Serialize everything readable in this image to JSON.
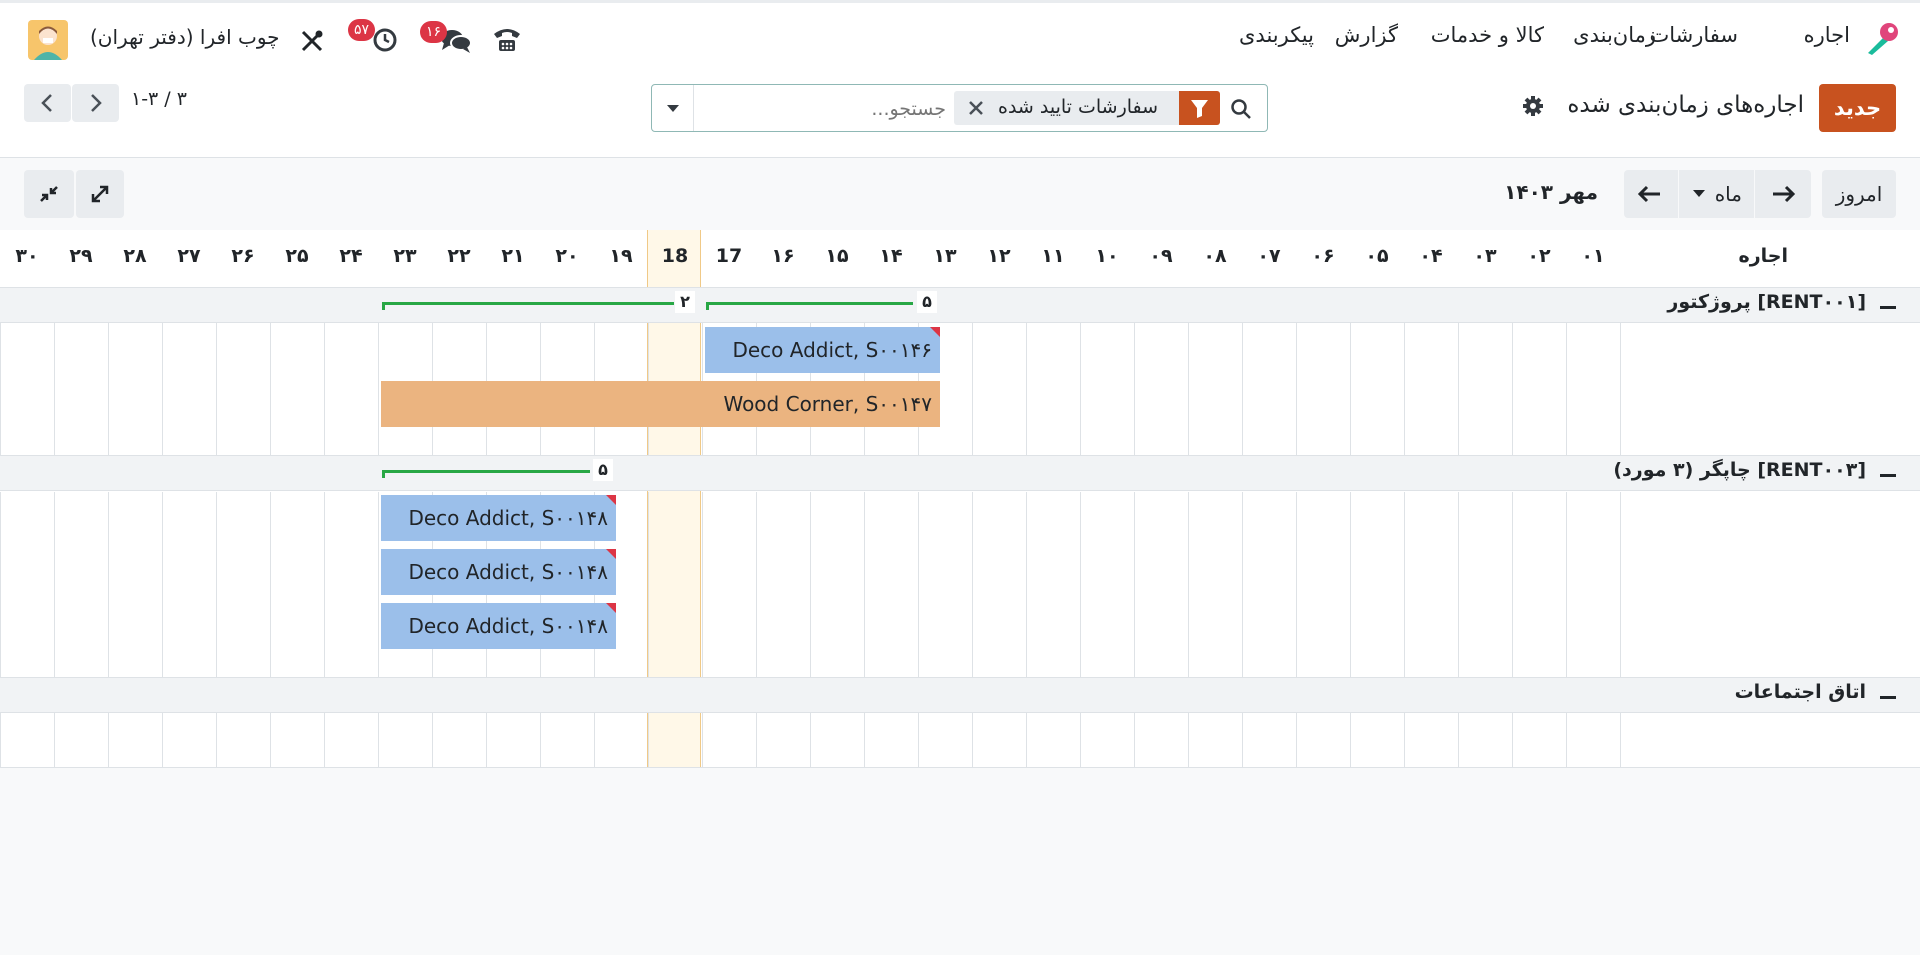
{
  "navbar": {
    "app_name": "اجاره",
    "menu": [
      "سفارشات",
      "زمان‌بندی",
      "کالا و خدمات",
      "گزارش",
      "پیکربندی"
    ],
    "company": "چوب افرا (دفتر تهران)",
    "chat_count": "۱۶",
    "activity_count": "۵۷"
  },
  "control": {
    "new_label": "جدید",
    "title": "اجاره‌های زمان‌بندی شده",
    "facet": "سفارشات تایید شده",
    "search_placeholder": "جستجو...",
    "pager": "۱-۳ / ۳"
  },
  "gantt": {
    "today_label": "امروز",
    "scale_label": "ماه",
    "period": "مهر ۱۴۰۳",
    "row_header": "اجاره",
    "days": [
      "۰۱",
      "۰۲",
      "۰۳",
      "۰۴",
      "۰۵",
      "۰۶",
      "۰۷",
      "۰۸",
      "۰۹",
      "۱۰",
      "۱۱",
      "۱۲",
      "۱۳",
      "۱۴",
      "۱۵",
      "۱۶",
      "17",
      "18",
      "۱۹",
      "۲۰",
      "۲۱",
      "۲۲",
      "۲۳",
      "۲۴",
      "۲۵",
      "۲۶",
      "۲۷",
      "۲۸",
      "۲۹",
      "۳۰"
    ],
    "groups": [
      {
        "label": "[RENT۰۰۱] پروژکتور",
        "aggregates": [
          "۵",
          "۲"
        ],
        "pills": [
          "Deco Addict, S۰۰۱۴۶",
          "Wood Corner, S۰۰۱۴۷"
        ]
      },
      {
        "label": "[RENT۰۰۳] چاپگر (۳ مورد)",
        "aggregates": [
          "۵"
        ],
        "pills": [
          "Deco Addict, S۰۰۱۴۸",
          "Deco Addict, S۰۰۱۴۸",
          "Deco Addict, S۰۰۱۴۸"
        ]
      },
      {
        "label": "اتاق اجتماعات",
        "aggregates": [],
        "pills": []
      }
    ]
  },
  "colors": {
    "accent": "#c8521f",
    "pill_blue": "#9bbfea",
    "pill_orange": "#ebb480",
    "badge": "#dc3545",
    "aggregate": "#28a745"
  }
}
